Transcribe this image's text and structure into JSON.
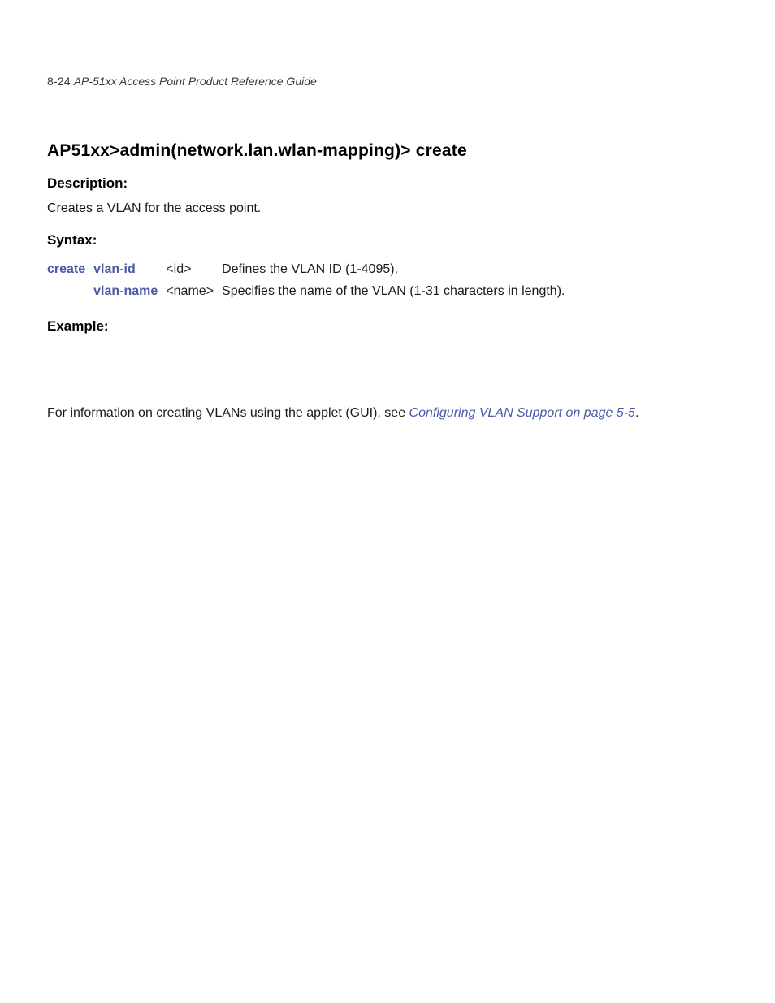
{
  "header": {
    "page_number": "8-24",
    "guide_title": "AP-51xx Access Point Product Reference Guide"
  },
  "section": {
    "title": "AP51xx>admin(network.lan.wlan-mapping)> create",
    "description_label": "Description:",
    "description_text": "Creates a VLAN for the access point.",
    "syntax_label": "Syntax:",
    "syntax_rows": [
      {
        "command": "create",
        "param": "vlan-id",
        "arg": "<id>",
        "desc": "Defines the VLAN ID (1-4095)."
      },
      {
        "command": "",
        "param": "vlan-name",
        "arg": "<name>",
        "desc": "Specifies the name of the VLAN (1-31 characters in length)."
      }
    ],
    "example_label": "Example:",
    "info_prefix": "For information on creating VLANs using the applet (GUI), see ",
    "info_link": "Configuring VLAN Support on page 5-5",
    "info_suffix": "."
  }
}
